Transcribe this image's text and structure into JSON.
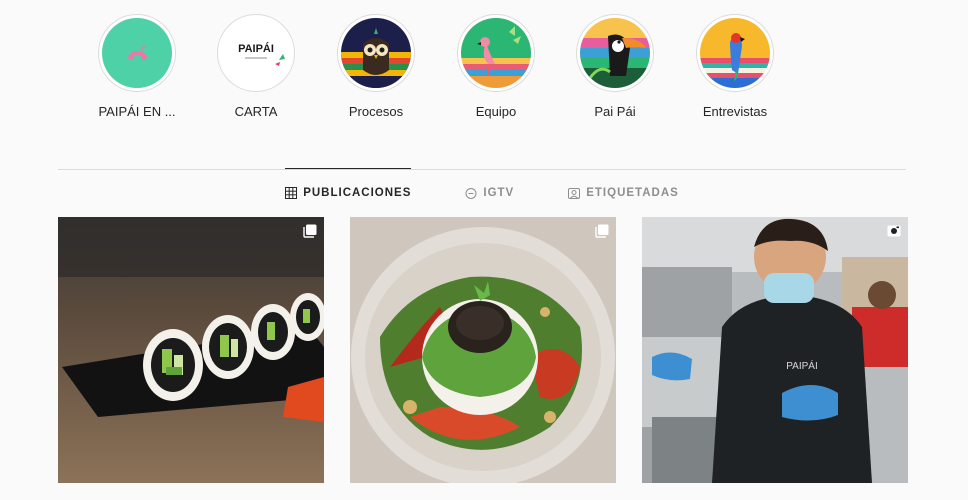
{
  "highlights": [
    {
      "label": "PAIPÁI EN ...",
      "icon": "scooter-icon"
    },
    {
      "label": "CARTA",
      "logo_text": "PAIPÁI"
    },
    {
      "label": "Procesos",
      "icon": "owl-icon"
    },
    {
      "label": "Equipo",
      "icon": "flamingo-icon"
    },
    {
      "label": "Pai Pái",
      "icon": "toucan-icon"
    },
    {
      "label": "Entrevistas",
      "icon": "parrot-icon"
    }
  ],
  "tabs": [
    {
      "label": "PUBLICACIONES",
      "icon": "grid-icon",
      "active": true
    },
    {
      "label": "IGTV",
      "icon": "igtv-icon",
      "active": false
    },
    {
      "label": "ETIQUETADAS",
      "icon": "tagged-icon",
      "active": false
    }
  ],
  "posts": [
    {
      "description": "sushi-rolls-photo",
      "badge": "carousel-icon"
    },
    {
      "description": "burrata-salad-photo",
      "badge": "carousel-icon"
    },
    {
      "description": "chef-in-kitchen-photo",
      "badge": "video-icon",
      "apron_text": "PAIPÁI"
    }
  ],
  "colors": {
    "mint": "#4fd1a8",
    "scooter_pink": "#e77aa8",
    "active_tab": "#262626",
    "inactive_tab": "#8e8e8e"
  }
}
